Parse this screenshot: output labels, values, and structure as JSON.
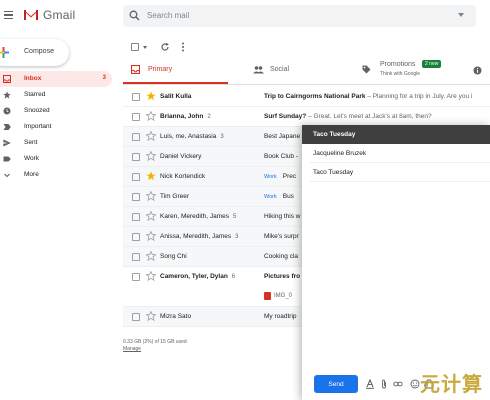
{
  "app": {
    "name": "Gmail"
  },
  "search": {
    "placeholder": "Search mail"
  },
  "compose_button": {
    "label": "Compose"
  },
  "sidebar": {
    "items": [
      {
        "label": "Inbox",
        "count": "3",
        "icon": "inbox-icon",
        "active": true
      },
      {
        "label": "Starred",
        "icon": "star-icon"
      },
      {
        "label": "Snoozed",
        "icon": "clock-icon"
      },
      {
        "label": "Important",
        "icon": "important-icon"
      },
      {
        "label": "Sent",
        "icon": "send-icon"
      },
      {
        "label": "Work",
        "icon": "label-icon"
      },
      {
        "label": "More",
        "icon": "chevron-down-icon"
      }
    ]
  },
  "tabs": {
    "primary": {
      "label": "Primary"
    },
    "social": {
      "label": "Social"
    },
    "promotions": {
      "label": "Promotions",
      "sub": "Think with Google",
      "badge": "2 new"
    }
  },
  "emails": [
    {
      "sender": "Salit Kulla",
      "count": "",
      "subject": "Trip to Cairngorms National Park",
      "snippet": " – Planning for a trip in July. Are you i",
      "starred": true,
      "unread": true,
      "label": ""
    },
    {
      "sender": "Brianna, John",
      "count": "2",
      "subject": "Surf Sunday?",
      "snippet": " – Great. Let's meet at Jack's at 8am, then?",
      "starred": false,
      "unread": true,
      "label": ""
    },
    {
      "sender": "Luis, me, Anastasia",
      "count": "3",
      "subject": "Best Japane",
      "snippet": "",
      "starred": false,
      "unread": false,
      "label": ""
    },
    {
      "sender": "Daniel Vickery",
      "count": "",
      "subject": "Book Club -",
      "snippet": "",
      "starred": false,
      "unread": false,
      "label": ""
    },
    {
      "sender": "Nick Kortendick",
      "count": "",
      "subject": "Prec",
      "snippet": "",
      "starred": true,
      "unread": false,
      "label": "Work"
    },
    {
      "sender": "Tim Greer",
      "count": "",
      "subject": "Bus",
      "snippet": "",
      "starred": false,
      "unread": false,
      "label": "Work"
    },
    {
      "sender": "Karen, Meredith, James",
      "count": "5",
      "subject": "Hiking this w",
      "snippet": "",
      "starred": false,
      "unread": false,
      "label": ""
    },
    {
      "sender": "Anissa, Meredith, James",
      "count": "3",
      "subject": "Mike's surpr",
      "snippet": "",
      "starred": false,
      "unread": false,
      "label": ""
    },
    {
      "sender": "Song Chi",
      "count": "",
      "subject": "Cooking cla",
      "snippet": "",
      "starred": false,
      "unread": false,
      "label": ""
    },
    {
      "sender": "Cameron, Tyler, Dylan",
      "count": "6",
      "subject": "Pictures fro",
      "snippet": "",
      "starred": false,
      "unread": true,
      "label": "",
      "attachment": "IMG_0"
    },
    {
      "sender": "Mizra Sato",
      "count": "",
      "subject": "My roadtrip",
      "snippet": "",
      "starred": false,
      "unread": false,
      "label": ""
    }
  ],
  "storage": {
    "text": "0.33 GB (2%) of 15 GB used",
    "manage": "Manage"
  },
  "compose_window": {
    "title": "Taco Tuesday",
    "to": "Jacqueline Bruzek",
    "subject": "Taco Tuesday",
    "send_label": "Send"
  },
  "watermark": "元计算",
  "colors": {
    "accent_red": "#d93025",
    "send_blue": "#1a73e8",
    "new_badge": "#188038",
    "star_yellow": "#f4b400"
  }
}
